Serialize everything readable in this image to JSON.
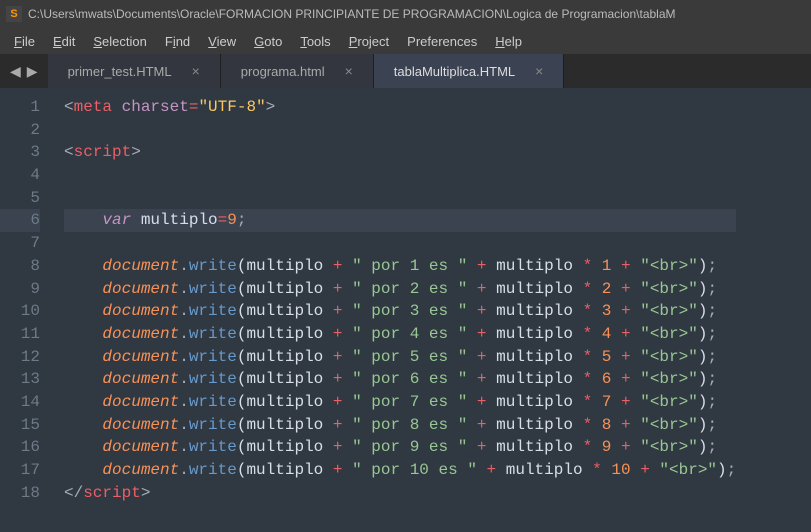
{
  "titlebar": {
    "icon_letter": "S",
    "path": "C:\\Users\\mwats\\Documents\\Oracle\\FORMACION PRINCIPIANTE DE PROGRAMACION\\Logica de Programacion\\tablaM"
  },
  "menubar": {
    "file": "File",
    "file_u": "F",
    "file_rest": "ile",
    "edit": "Edit",
    "edit_u": "E",
    "edit_rest": "dit",
    "selection": "Selection",
    "selection_u": "S",
    "selection_rest": "election",
    "find": "Find",
    "find_u": "F",
    "find_mid": "i",
    "find_rest": "nd",
    "view": "View",
    "view_u": "V",
    "view_rest": "iew",
    "goto": "Goto",
    "goto_u": "G",
    "goto_rest": "oto",
    "tools": "Tools",
    "tools_u": "T",
    "tools_rest": "ools",
    "project": "Project",
    "project_u": "P",
    "project_rest": "roject",
    "preferences": "Preferences",
    "help": "Help",
    "help_u": "H",
    "help_rest": "elp"
  },
  "tabs": [
    {
      "label": "primer_test.HTML",
      "active": false
    },
    {
      "label": "programa.html",
      "active": false
    },
    {
      "label": "tablaMultiplica.HTML",
      "active": true
    }
  ],
  "editor": {
    "current_line": 6,
    "lines": [
      1,
      2,
      3,
      4,
      5,
      6,
      7,
      8,
      9,
      10,
      11,
      12,
      13,
      14,
      15,
      16,
      17,
      18
    ]
  },
  "tokens": {
    "meta": "meta",
    "charset": "charset",
    "eq": "=",
    "utf8": "\"UTF-8\"",
    "script": "script",
    "var": "var",
    "multiplo": "multiplo",
    "nine": "9",
    "document": "document",
    "write": "write",
    "plus": "+",
    "star": "*",
    "semi": ";",
    "lparen": "(",
    "rparen": ")",
    "dot": ".",
    "lt": "<",
    "gt": ">",
    "slash": "/",
    "por": [
      "\" por 1 es \"",
      "\" por 2 es \"",
      "\" por 3 es \"",
      "\" por 4 es \"",
      "\" por 5 es \"",
      "\" por 6 es \"",
      "\" por 7 es \"",
      "\" por 8 es \"",
      "\" por 9 es \"",
      "\" por 10 es \""
    ],
    "nums": [
      "1",
      "2",
      "3",
      "4",
      "5",
      "6",
      "7",
      "8",
      "9",
      "10"
    ],
    "br": "\"<br>\""
  }
}
